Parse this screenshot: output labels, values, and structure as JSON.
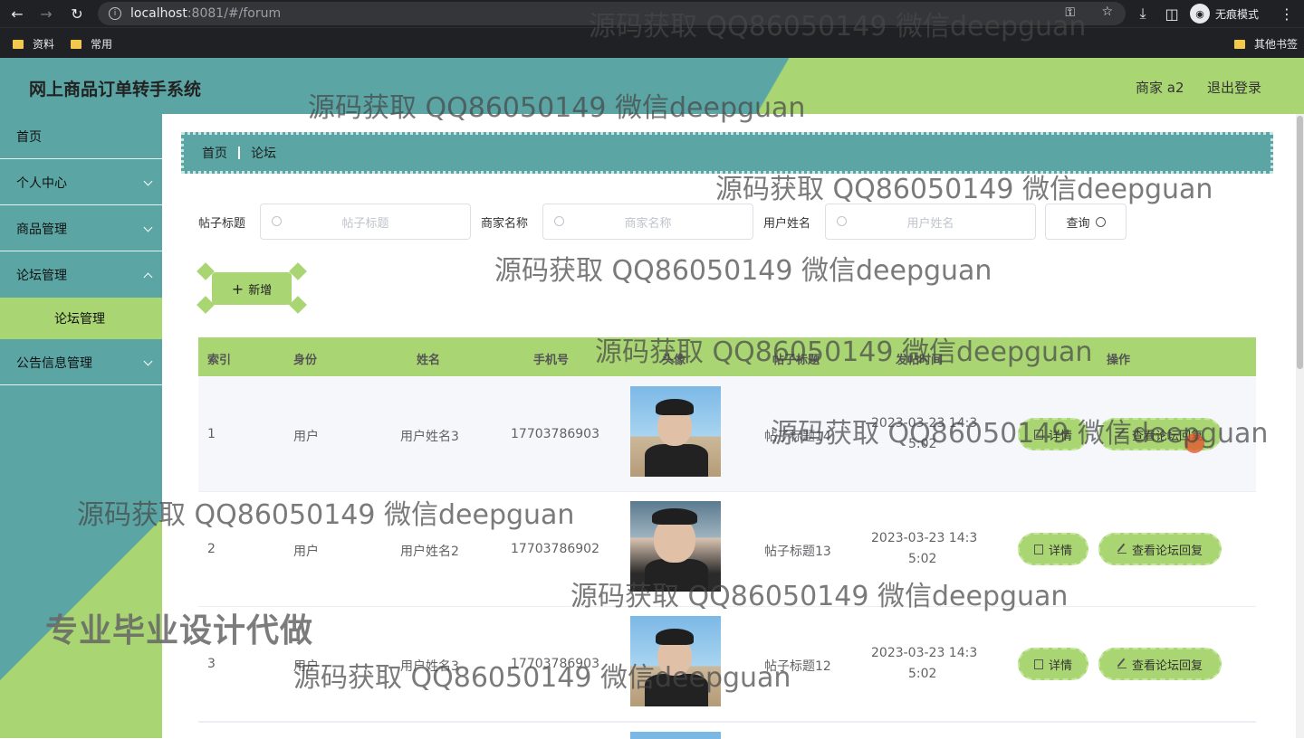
{
  "browser": {
    "url_host": "localhost",
    "url_rest": ":8081/#/forum",
    "incognito_label": "无痕模式",
    "bookmarks": [
      "资料",
      "常用"
    ],
    "other_bookmarks": "其他书签"
  },
  "header": {
    "title": "网上商品订单转手系统",
    "user": "商家 a2",
    "logout": "退出登录"
  },
  "sidebar": {
    "items": [
      {
        "label": "首页"
      },
      {
        "label": "个人中心"
      },
      {
        "label": "商品管理"
      },
      {
        "label": "论坛管理"
      },
      {
        "label": "公告信息管理"
      }
    ],
    "sub_item": "论坛管理",
    "slogan": "专业毕业设计代做"
  },
  "breadcrumb": {
    "home": "首页",
    "current": "论坛"
  },
  "search": {
    "title_label": "帖子标题",
    "title_placeholder": "帖子标题",
    "merchant_label": "商家名称",
    "merchant_placeholder": "商家名称",
    "user_label": "用户姓名",
    "user_placeholder": "用户姓名",
    "query_button": "查询"
  },
  "add_button": "新增",
  "table": {
    "headers": [
      "索引",
      "身份",
      "姓名",
      "手机号",
      "头像",
      "帖子标题",
      "发帖时间",
      "操作"
    ],
    "rows": [
      {
        "index": "1",
        "role": "用户",
        "name": "用户姓名3",
        "phone": "17703786903",
        "title": "帖子标题14",
        "time_line1": "2023-03-23 14:3",
        "time_line2": "5:02",
        "detail": "详情",
        "reply": "查看论坛回复"
      },
      {
        "index": "2",
        "role": "用户",
        "name": "用户姓名2",
        "phone": "17703786902",
        "title": "帖子标题13",
        "time_line1": "2023-03-23 14:3",
        "time_line2": "5:02",
        "detail": "详情",
        "reply": "查看论坛回复"
      },
      {
        "index": "3",
        "role": "用户",
        "name": "用户姓名3",
        "phone": "17703786903",
        "title": "帖子标题12",
        "time_line1": "2023-03-23 14:3",
        "time_line2": "5:02",
        "detail": "详情",
        "reply": "查看论坛回复"
      }
    ]
  },
  "watermark": "源码获取 QQ86050149 微信deepguan"
}
